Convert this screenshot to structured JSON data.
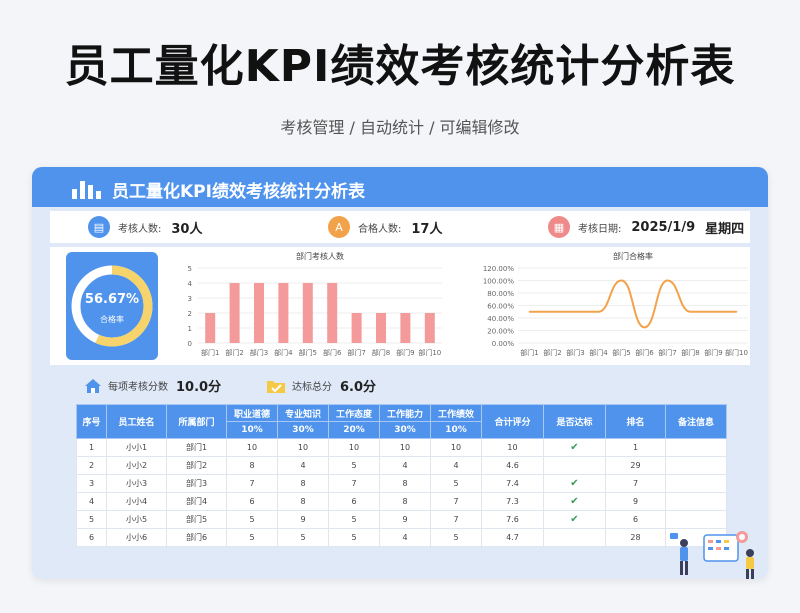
{
  "page": {
    "title": "员工量化KPI绩效考核统计分析表",
    "subtitle": "考核管理 / 自动统计 / 可编辑修改"
  },
  "header": {
    "title": "员工量化KPI绩效考核统计分析表"
  },
  "info": {
    "count_label": "考核人数:",
    "count_value": "30人",
    "pass_label": "合格人数:",
    "pass_value": "17人",
    "date_label": "考核日期:",
    "date_value": "2025/1/9",
    "weekday": "星期四"
  },
  "ring": {
    "percent_text": "56.67%",
    "label": "合格率",
    "value": 0.5667
  },
  "stats": {
    "per_item_label": "每项考核分数",
    "per_item_value": "10.0分",
    "pass_total_label": "达标总分",
    "pass_total_value": "6.0分"
  },
  "colors": {
    "primary": "#4f93ec",
    "bar": "#f49a9a",
    "line": "#f2a24a",
    "ring": "#f6d36b"
  },
  "chart_data": [
    {
      "type": "bar",
      "title": "部门考核人数",
      "categories": [
        "部门1",
        "部门2",
        "部门3",
        "部门4",
        "部门5",
        "部门6",
        "部门7",
        "部门8",
        "部门9",
        "部门10"
      ],
      "values": [
        2,
        4,
        4,
        4,
        4,
        4,
        2,
        2,
        2,
        2
      ],
      "ylim": [
        0,
        5
      ],
      "yticks": [
        "0",
        "1",
        "2",
        "3",
        "4",
        "5"
      ]
    },
    {
      "type": "line",
      "title": "部门合格率",
      "categories": [
        "部门1",
        "部门2",
        "部门3",
        "部门4",
        "部门5",
        "部门6",
        "部门7",
        "部门8",
        "部门9",
        "部门10"
      ],
      "values": [
        0.5,
        0.5,
        0.5,
        0.5,
        1.0,
        0.25,
        1.0,
        0.5,
        0.5,
        0.5
      ],
      "ylim": [
        0,
        1.2
      ],
      "yticks": [
        "0.00%",
        "20.00%",
        "40.00%",
        "60.00%",
        "80.00%",
        "100.00%",
        "120.00%"
      ]
    }
  ],
  "table": {
    "headers": {
      "no": "序号",
      "name": "员工姓名",
      "dept": "所属部门",
      "c1": "职业道德",
      "c2": "专业知识",
      "c3": "工作态度",
      "c4": "工作能力",
      "c5": "工作绩效",
      "total": "合计评分",
      "pass": "是否达标",
      "rank": "排名",
      "note": "备注信息"
    },
    "weights": [
      "10%",
      "30%",
      "20%",
      "30%",
      "10%"
    ],
    "rows": [
      {
        "no": "1",
        "name": "小小1",
        "dept": "部门1",
        "c1": "10",
        "c2": "10",
        "c3": "10",
        "c4": "10",
        "c5": "10",
        "total": "10",
        "pass": "✔",
        "rank": "1",
        "note": ""
      },
      {
        "no": "2",
        "name": "小小2",
        "dept": "部门2",
        "c1": "8",
        "c2": "4",
        "c3": "5",
        "c4": "4",
        "c5": "4",
        "total": "4.6",
        "pass": "",
        "rank": "29",
        "note": ""
      },
      {
        "no": "3",
        "name": "小小3",
        "dept": "部门3",
        "c1": "7",
        "c2": "8",
        "c3": "7",
        "c4": "8",
        "c5": "5",
        "total": "7.4",
        "pass": "✔",
        "rank": "7",
        "note": ""
      },
      {
        "no": "4",
        "name": "小小4",
        "dept": "部门4",
        "c1": "6",
        "c2": "8",
        "c3": "6",
        "c4": "8",
        "c5": "7",
        "total": "7.3",
        "pass": "✔",
        "rank": "9",
        "note": ""
      },
      {
        "no": "5",
        "name": "小小5",
        "dept": "部门5",
        "c1": "5",
        "c2": "9",
        "c3": "5",
        "c4": "9",
        "c5": "7",
        "total": "7.6",
        "pass": "✔",
        "rank": "6",
        "note": ""
      },
      {
        "no": "6",
        "name": "小小6",
        "dept": "部门6",
        "c1": "5",
        "c2": "5",
        "c3": "5",
        "c4": "4",
        "c5": "5",
        "total": "4.7",
        "pass": "",
        "rank": "28",
        "note": ""
      }
    ]
  }
}
